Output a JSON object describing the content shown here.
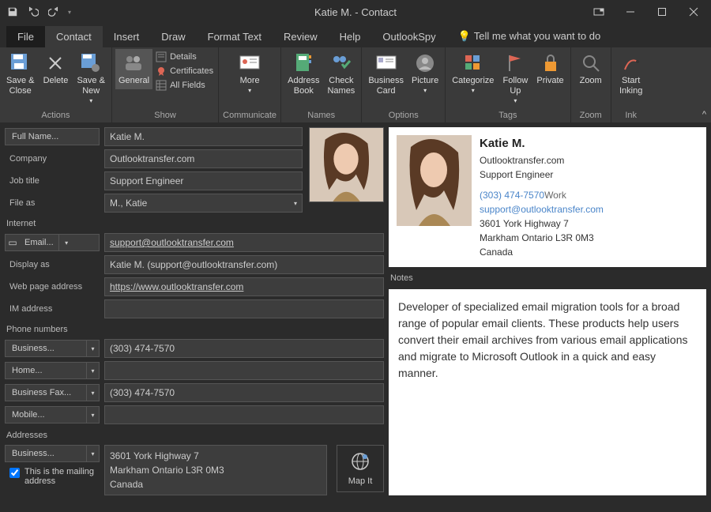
{
  "window": {
    "title": "Katie M.  -  Contact"
  },
  "menu": {
    "file": "File",
    "contact": "Contact",
    "insert": "Insert",
    "draw": "Draw",
    "format": "Format Text",
    "review": "Review",
    "help": "Help",
    "outlookspy": "OutlookSpy",
    "tellme": "Tell me what you want to do"
  },
  "ribbon": {
    "actions": {
      "label": "Actions",
      "save_close": "Save &\nClose",
      "delete": "Delete",
      "save_new": "Save &\nNew"
    },
    "show": {
      "label": "Show",
      "general": "General",
      "details": "Details",
      "certificates": "Certificates",
      "all_fields": "All Fields"
    },
    "communicate": {
      "label": "Communicate",
      "more": "More"
    },
    "names": {
      "label": "Names",
      "address_book": "Address\nBook",
      "check_names": "Check\nNames"
    },
    "options": {
      "label": "Options",
      "business_card": "Business\nCard",
      "picture": "Picture"
    },
    "tags": {
      "label": "Tags",
      "categorize": "Categorize",
      "follow_up": "Follow\nUp",
      "private": "Private"
    },
    "zoom": {
      "label": "Zoom",
      "zoom": "Zoom"
    },
    "ink": {
      "label": "Ink",
      "start_inking": "Start\nInking"
    }
  },
  "labels": {
    "full_name": "Full Name...",
    "company": "Company",
    "job_title": "Job title",
    "file_as": "File as",
    "internet": "Internet",
    "email": "Email...",
    "display_as": "Display as",
    "web_page": "Web page address",
    "im": "IM address",
    "phone": "Phone numbers",
    "business": "Business...",
    "home": "Home...",
    "business_fax": "Business Fax...",
    "mobile": "Mobile...",
    "addresses": "Addresses",
    "addr_business": "Business...",
    "mailing": "This is the mailing address",
    "map_it": "Map It",
    "notes": "Notes"
  },
  "fields": {
    "full_name": "Katie M.",
    "company": "Outlooktransfer.com",
    "job_title": "Support Engineer",
    "file_as": "M., Katie",
    "email": "support@outlooktransfer.com",
    "display_as": "Katie M. (support@outlooktransfer.com)",
    "web_page": "https://www.outlooktransfer.com",
    "im": "",
    "phone_business": "(303) 474-7570",
    "phone_home": "",
    "phone_fax": "(303) 474-7570",
    "phone_mobile": "",
    "address_line1": "3601 York Highway 7",
    "address_line2": "Markham  Ontario  L3R 0M3",
    "address_line3": "Canada"
  },
  "card": {
    "name": "Katie M.",
    "company": "Outlooktransfer.com",
    "title": "Support Engineer",
    "phone": "(303) 474-7570",
    "phone_label": "Work",
    "email": "support@outlooktransfer.com",
    "addr1": "3601 York Highway 7",
    "addr2": "Markham  Ontario  L3R 0M3",
    "addr3": "Canada"
  },
  "notes": "Developer of specialized email migration tools for a broad range of popular email clients. These products help users convert their email archives from various email applications and migrate to Microsoft Outlook in a quick and easy manner."
}
